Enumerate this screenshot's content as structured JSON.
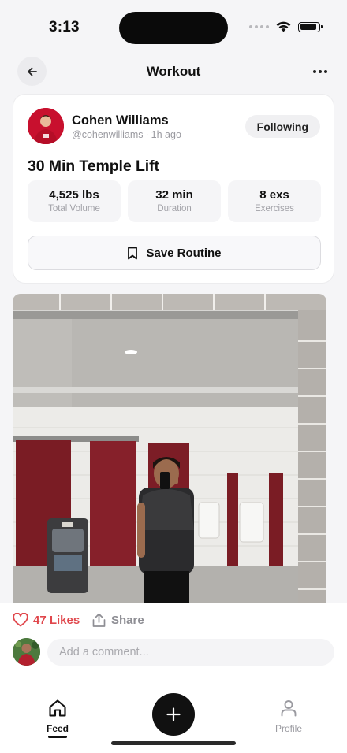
{
  "status_bar": {
    "time": "3:13",
    "battery_level": 0.9
  },
  "nav": {
    "title": "Workout"
  },
  "post": {
    "user": {
      "name": "Cohen Williams",
      "handle": "@cohenwilliams",
      "separator": "·",
      "time_ago": "1h ago"
    },
    "follow_label": "Following",
    "workout_title": "30 Min Temple Lift",
    "stats": [
      {
        "value": "4,525 lbs",
        "label": "Total Volume"
      },
      {
        "value": "32 min",
        "label": "Duration"
      },
      {
        "value": "8 exs",
        "label": "Exercises"
      }
    ],
    "save_routine_label": "Save Routine"
  },
  "engagement": {
    "likes_label": "47 Likes",
    "share_label": "Share",
    "comment_placeholder": "Add a comment..."
  },
  "tabs": {
    "feed_label": "Feed",
    "profile_label": "Profile"
  },
  "colors": {
    "like": "#e0474c",
    "accent_dark": "#111111"
  }
}
